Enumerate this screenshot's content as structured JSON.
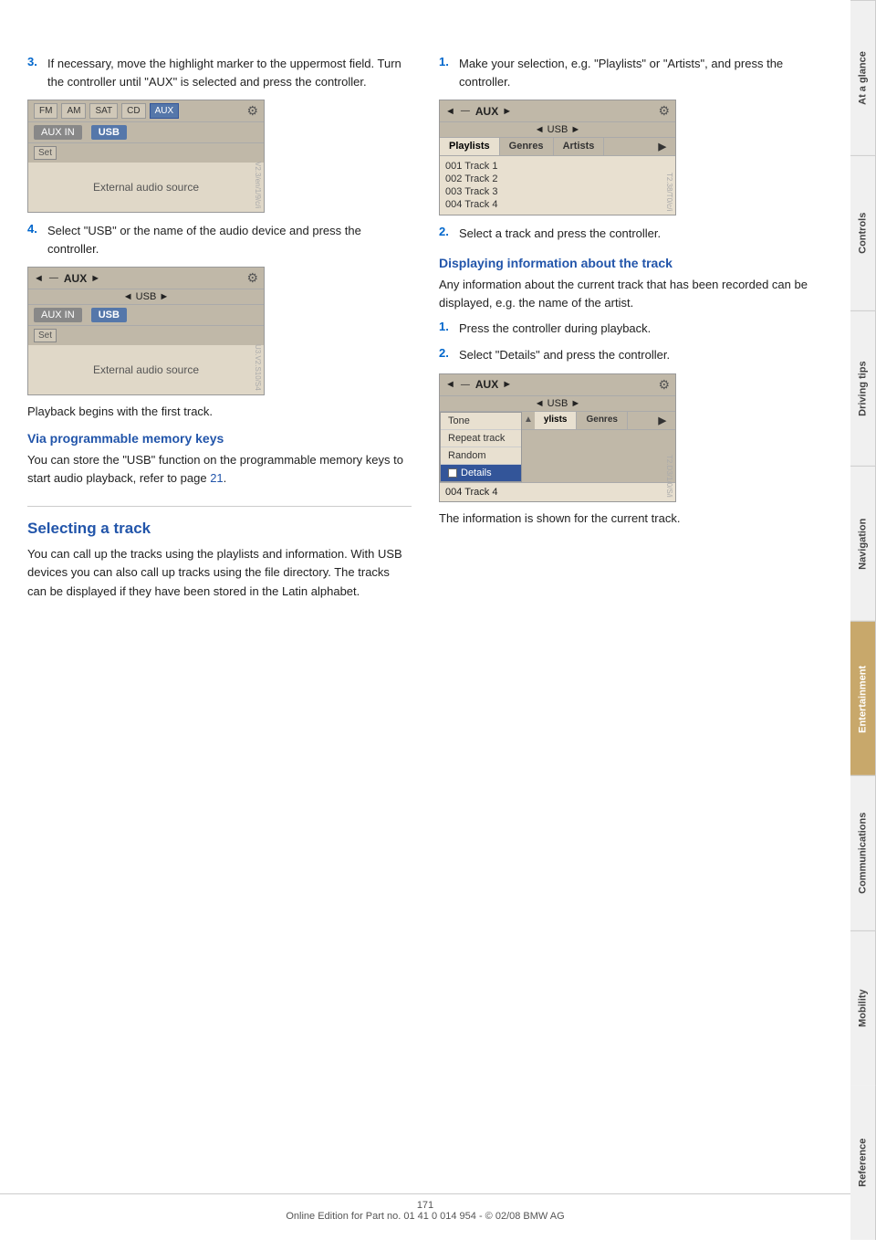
{
  "page": {
    "number": "171",
    "footer_text": "Online Edition for Part no. 01 41 0 014 954  - © 02/08 BMW AG"
  },
  "side_tabs": [
    {
      "label": "At a glance",
      "active": false
    },
    {
      "label": "Controls",
      "active": false
    },
    {
      "label": "Driving tips",
      "active": false
    },
    {
      "label": "Navigation",
      "active": false
    },
    {
      "label": "Entertainment",
      "active": true
    },
    {
      "label": "Communications",
      "active": false
    },
    {
      "label": "Mobility",
      "active": false
    },
    {
      "label": "Reference",
      "active": false
    }
  ],
  "left_col": {
    "step3": {
      "num": "3.",
      "text": "If necessary, move the highlight marker to the uppermost field. Turn the controller until \"AUX\" is selected and press the controller."
    },
    "screen1": {
      "fm": "FM",
      "am": "AM",
      "sat": "SAT",
      "cd": "CD",
      "aux": "AUX",
      "aux_in": "AUX IN",
      "usb": "USB",
      "set": "Set",
      "ext_audio": "External audio source"
    },
    "step4": {
      "num": "4.",
      "text": "Select \"USB\" or the name of the audio device and press the controller."
    },
    "screen2": {
      "nav_left": "◄",
      "label_aux": "AUX",
      "nav_right": "►",
      "usb_label": "◄ USB ►",
      "aux_in": "AUX IN",
      "usb": "USB",
      "set": "Set",
      "ext_audio": "External audio source"
    },
    "playback_note": "Playback begins with the first track.",
    "via_heading": "Via programmable memory keys",
    "via_text": "You can store the \"USB\" function on the programmable memory keys to start audio playback, refer to page ",
    "via_link": "21",
    "via_text2": ".",
    "selecting_heading": "Selecting a track",
    "selecting_text": "You can call up the tracks using the playlists and information. With USB devices you can also call up tracks using the file directory. The tracks can be displayed if they have been stored in the Latin alphabet."
  },
  "right_col": {
    "step1": {
      "num": "1.",
      "text": "Make your selection, e.g. \"Playlists\" or \"Artists\", and press the controller."
    },
    "screen3": {
      "nav_left": "◄",
      "label_aux": "AUX",
      "nav_right": "►",
      "usb_label": "◄ USB ►",
      "tab_playlists": "Playlists",
      "tab_genres": "Genres",
      "tab_artists": "Artists",
      "track1": "001 Track 1",
      "track2": "002 Track 2",
      "track3": "003 Track 3",
      "track4": "004 Track 4"
    },
    "step2_right": {
      "num": "2.",
      "text": "Select a track and press the controller."
    },
    "displaying_heading": "Displaying information about the track",
    "displaying_text": "Any information about the current track that has been recorded can be displayed, e.g. the name of the artist.",
    "step_r1": {
      "num": "1.",
      "text": "Press the controller during playback."
    },
    "step_r2": {
      "num": "2.",
      "text": "Select \"Details\" and press the controller."
    },
    "screen4": {
      "nav_left": "◄",
      "label_aux": "AUX",
      "nav_right": "►",
      "usb_label": "◄ USB ►",
      "menu_tone": "Tone",
      "menu_repeat": "Repeat track",
      "menu_random": "Random",
      "menu_details": "Details",
      "track4": "004 Track 4",
      "tab_ylists": "ylists",
      "tab_genres": "Genres"
    },
    "info_line": "The information is shown for the current track."
  }
}
